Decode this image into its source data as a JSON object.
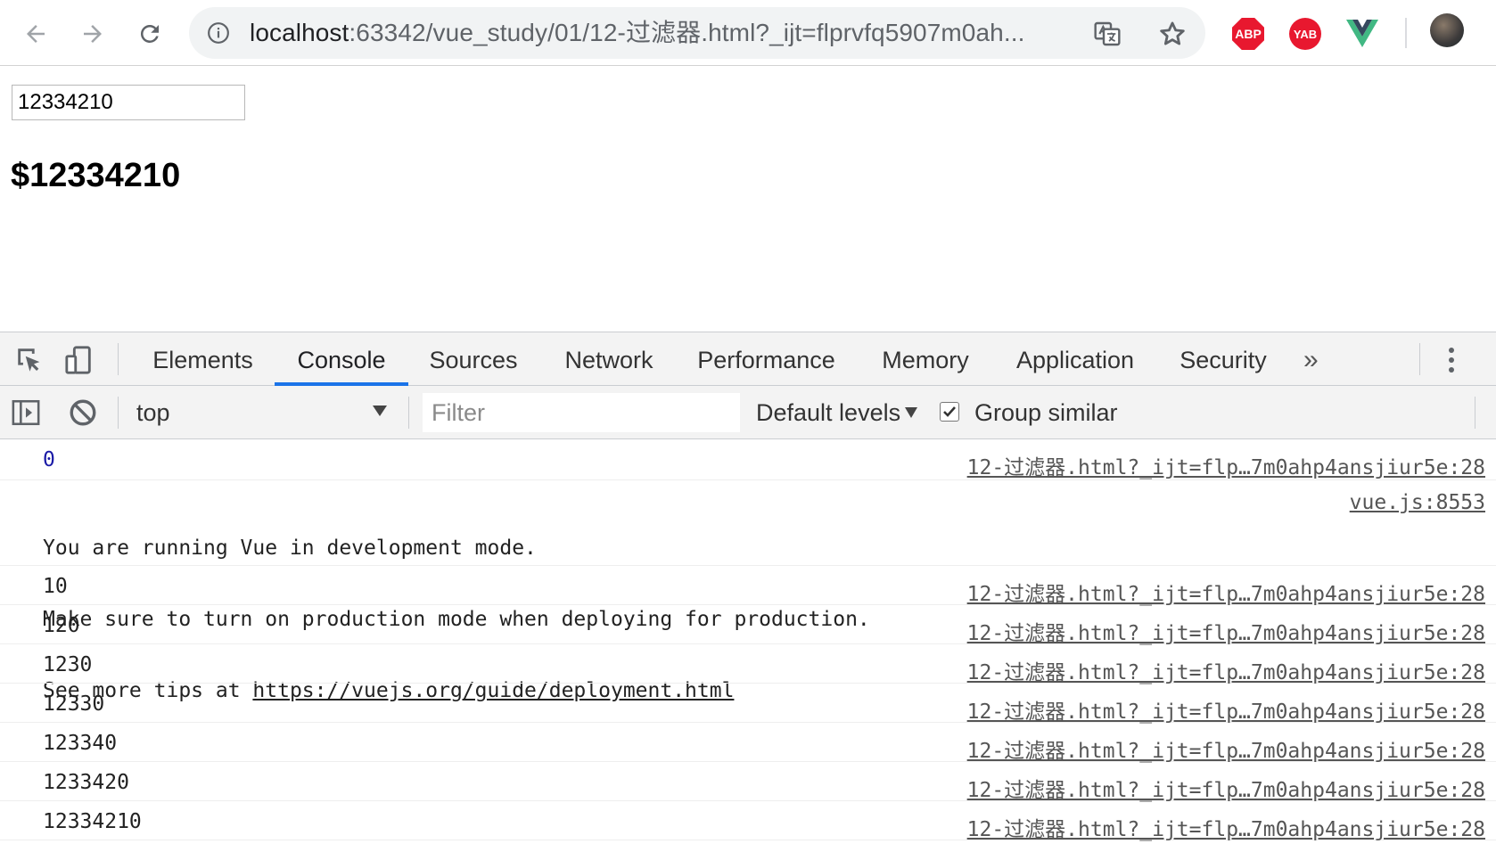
{
  "browser": {
    "url_host": "localhost",
    "url_rest": ":63342/vue_study/01/12-过滤器.html?_ijt=flprvfq5907m0ah...",
    "extensions": [
      "ABP",
      "YAB"
    ]
  },
  "page": {
    "input_value": "12334210",
    "output_text": "$12334210"
  },
  "devtools": {
    "tabs": [
      "Elements",
      "Console",
      "Sources",
      "Network",
      "Performance",
      "Memory",
      "Application",
      "Security"
    ],
    "active_tab": "Console",
    "more_tabs": "»",
    "context": "top",
    "filter_placeholder": "Filter",
    "levels_label": "Default levels",
    "group_similar_label": "Group similar",
    "group_similar_checked": true
  },
  "console": {
    "source_ref": "12-过滤器.html?_ijt=flp…7m0ahp4ansjiur5e:28",
    "first_value": "0",
    "vue_message": {
      "line1": "You are running Vue in development mode.",
      "line2": "Make sure to turn on production mode when deploying for production.",
      "line3_prefix": "See more tips at ",
      "line3_link": "https://vuejs.org/guide/deployment.html",
      "source": "vue.js:8553"
    },
    "values": [
      "10",
      "120",
      "1230",
      "12330",
      "123340",
      "1233420",
      "12334210"
    ]
  },
  "colors": {
    "accent": "#1a73e8",
    "number_blue": "#1a1aa6",
    "abp_red": "#e8182f",
    "vue_green": "#41b883"
  }
}
